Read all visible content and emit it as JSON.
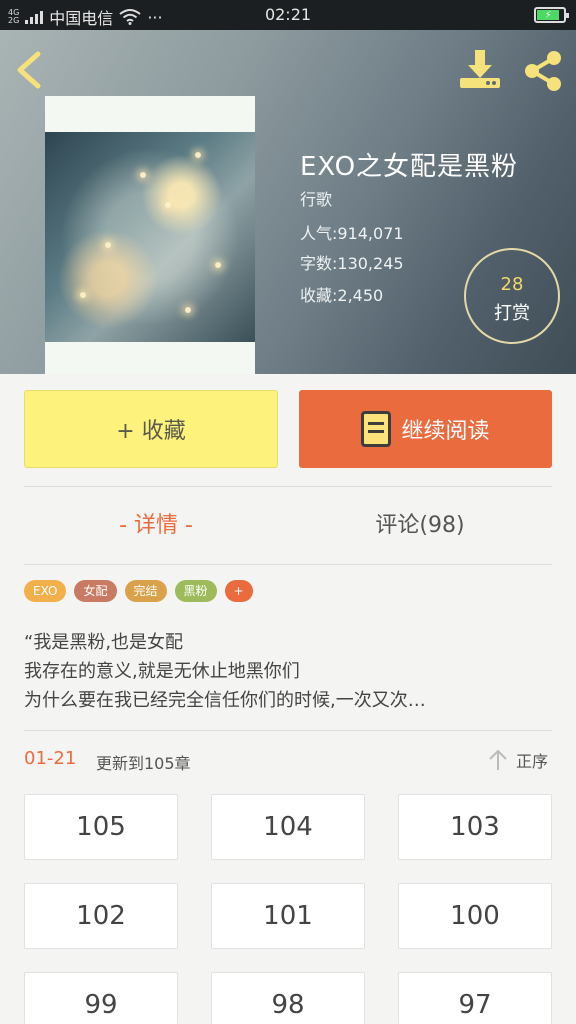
{
  "status_bar": {
    "network_top": "4G",
    "network_bottom": "2G",
    "carrier": "中国电信",
    "more": "···",
    "time": "02:21"
  },
  "book": {
    "title": "EXO之女配是黑粉",
    "author": "行歌",
    "popularity": "人气:914,071",
    "word_count": "字数:130,245",
    "favorites": "收藏:2,450",
    "reward_count": "28",
    "reward_label": "打赏"
  },
  "actions": {
    "collect_label": "+ 收藏",
    "read_label": "继续阅读"
  },
  "tabs": {
    "detail": "- 详情 -",
    "comments": "评论(98)"
  },
  "tags": [
    {
      "label": "EXO",
      "color": "#f2b04a"
    },
    {
      "label": "女配",
      "color": "#c87a62"
    },
    {
      "label": "完结",
      "color": "#d9a24a"
    },
    {
      "label": "黑粉",
      "color": "#9dbb5a"
    },
    {
      "label": "+",
      "color": "#ea6b3e"
    }
  ],
  "description": [
    "“我是黑粉,也是女配",
    "我存在的意义,就是无休止地黑你们",
    "为什么要在我已经完全信任你们的时候,一次又次…"
  ],
  "update": {
    "date": "01-21",
    "text": "更新到105章",
    "sort_label": "正序"
  },
  "chapters": [
    "105",
    "104",
    "103",
    "102",
    "101",
    "100",
    "99",
    "98",
    "97"
  ],
  "colors": {
    "accent": "#ea6b3e",
    "collect_button": "#fcf27c",
    "icon_yellow": "#f6e27a"
  }
}
